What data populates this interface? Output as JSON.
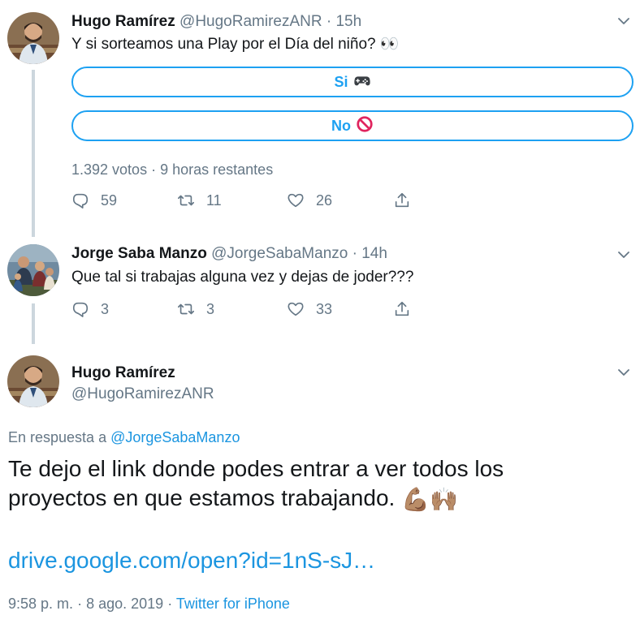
{
  "tweet1": {
    "name": "Hugo Ramírez",
    "handle": "@HugoRamirezANR",
    "separator": "·",
    "time": "15h",
    "text": "Y si sorteamos una Play por el Día del niño? 👀",
    "poll": {
      "options": [
        {
          "label": "Si",
          "icon": "gamepad-icon"
        },
        {
          "label": "No",
          "icon": "prohibited-icon"
        }
      ],
      "votes": "1.392 votos",
      "remaining": "9 horas restantes",
      "meta_sep": "·"
    },
    "actions": {
      "replies": "59",
      "retweets": "11",
      "likes": "26"
    }
  },
  "tweet2": {
    "name": "Jorge Saba Manzo",
    "handle": "@JorgeSabaManzo",
    "separator": "·",
    "time": "14h",
    "text": "Que tal si trabajas alguna vez y dejas de joder???",
    "actions": {
      "replies": "3",
      "retweets": "3",
      "likes": "33"
    }
  },
  "main_tweet": {
    "name": "Hugo Ramírez",
    "handle": "@HugoRamirezANR",
    "reply_prefix": "En respuesta a",
    "reply_to": "@JorgeSabaManzo",
    "text_line1": "Te dejo el link donde podes entrar a ver todos los",
    "text_line2": "proyectos en que estamos trabajando.",
    "emojis": "💪🏽🙌🏽",
    "link": "drive.google.com/open?id=1nS-sJ…",
    "time": "9:58 p. m.",
    "date_sep": "·",
    "date": "8 ago. 2019",
    "source_sep": "·",
    "source": "Twitter for iPhone"
  },
  "colors": {
    "accent": "#1da1f2",
    "link": "#1b95e0",
    "muted": "#657786",
    "text": "#14171a",
    "thread_line": "#ccd6dd"
  }
}
